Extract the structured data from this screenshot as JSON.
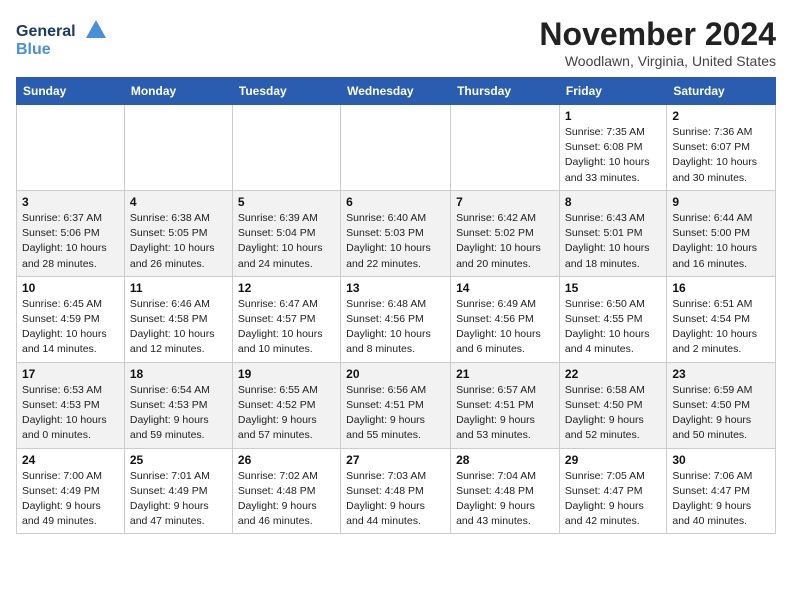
{
  "header": {
    "logo_line1": "General",
    "logo_line2": "Blue",
    "month": "November 2024",
    "location": "Woodlawn, Virginia, United States"
  },
  "weekdays": [
    "Sunday",
    "Monday",
    "Tuesday",
    "Wednesday",
    "Thursday",
    "Friday",
    "Saturday"
  ],
  "weeks": [
    [
      {
        "day": "",
        "info": ""
      },
      {
        "day": "",
        "info": ""
      },
      {
        "day": "",
        "info": ""
      },
      {
        "day": "",
        "info": ""
      },
      {
        "day": "",
        "info": ""
      },
      {
        "day": "1",
        "info": "Sunrise: 7:35 AM\nSunset: 6:08 PM\nDaylight: 10 hours\nand 33 minutes."
      },
      {
        "day": "2",
        "info": "Sunrise: 7:36 AM\nSunset: 6:07 PM\nDaylight: 10 hours\nand 30 minutes."
      }
    ],
    [
      {
        "day": "3",
        "info": "Sunrise: 6:37 AM\nSunset: 5:06 PM\nDaylight: 10 hours\nand 28 minutes."
      },
      {
        "day": "4",
        "info": "Sunrise: 6:38 AM\nSunset: 5:05 PM\nDaylight: 10 hours\nand 26 minutes."
      },
      {
        "day": "5",
        "info": "Sunrise: 6:39 AM\nSunset: 5:04 PM\nDaylight: 10 hours\nand 24 minutes."
      },
      {
        "day": "6",
        "info": "Sunrise: 6:40 AM\nSunset: 5:03 PM\nDaylight: 10 hours\nand 22 minutes."
      },
      {
        "day": "7",
        "info": "Sunrise: 6:42 AM\nSunset: 5:02 PM\nDaylight: 10 hours\nand 20 minutes."
      },
      {
        "day": "8",
        "info": "Sunrise: 6:43 AM\nSunset: 5:01 PM\nDaylight: 10 hours\nand 18 minutes."
      },
      {
        "day": "9",
        "info": "Sunrise: 6:44 AM\nSunset: 5:00 PM\nDaylight: 10 hours\nand 16 minutes."
      }
    ],
    [
      {
        "day": "10",
        "info": "Sunrise: 6:45 AM\nSunset: 4:59 PM\nDaylight: 10 hours\nand 14 minutes."
      },
      {
        "day": "11",
        "info": "Sunrise: 6:46 AM\nSunset: 4:58 PM\nDaylight: 10 hours\nand 12 minutes."
      },
      {
        "day": "12",
        "info": "Sunrise: 6:47 AM\nSunset: 4:57 PM\nDaylight: 10 hours\nand 10 minutes."
      },
      {
        "day": "13",
        "info": "Sunrise: 6:48 AM\nSunset: 4:56 PM\nDaylight: 10 hours\nand 8 minutes."
      },
      {
        "day": "14",
        "info": "Sunrise: 6:49 AM\nSunset: 4:56 PM\nDaylight: 10 hours\nand 6 minutes."
      },
      {
        "day": "15",
        "info": "Sunrise: 6:50 AM\nSunset: 4:55 PM\nDaylight: 10 hours\nand 4 minutes."
      },
      {
        "day": "16",
        "info": "Sunrise: 6:51 AM\nSunset: 4:54 PM\nDaylight: 10 hours\nand 2 minutes."
      }
    ],
    [
      {
        "day": "17",
        "info": "Sunrise: 6:53 AM\nSunset: 4:53 PM\nDaylight: 10 hours\nand 0 minutes."
      },
      {
        "day": "18",
        "info": "Sunrise: 6:54 AM\nSunset: 4:53 PM\nDaylight: 9 hours\nand 59 minutes."
      },
      {
        "day": "19",
        "info": "Sunrise: 6:55 AM\nSunset: 4:52 PM\nDaylight: 9 hours\nand 57 minutes."
      },
      {
        "day": "20",
        "info": "Sunrise: 6:56 AM\nSunset: 4:51 PM\nDaylight: 9 hours\nand 55 minutes."
      },
      {
        "day": "21",
        "info": "Sunrise: 6:57 AM\nSunset: 4:51 PM\nDaylight: 9 hours\nand 53 minutes."
      },
      {
        "day": "22",
        "info": "Sunrise: 6:58 AM\nSunset: 4:50 PM\nDaylight: 9 hours\nand 52 minutes."
      },
      {
        "day": "23",
        "info": "Sunrise: 6:59 AM\nSunset: 4:50 PM\nDaylight: 9 hours\nand 50 minutes."
      }
    ],
    [
      {
        "day": "24",
        "info": "Sunrise: 7:00 AM\nSunset: 4:49 PM\nDaylight: 9 hours\nand 49 minutes."
      },
      {
        "day": "25",
        "info": "Sunrise: 7:01 AM\nSunset: 4:49 PM\nDaylight: 9 hours\nand 47 minutes."
      },
      {
        "day": "26",
        "info": "Sunrise: 7:02 AM\nSunset: 4:48 PM\nDaylight: 9 hours\nand 46 minutes."
      },
      {
        "day": "27",
        "info": "Sunrise: 7:03 AM\nSunset: 4:48 PM\nDaylight: 9 hours\nand 44 minutes."
      },
      {
        "day": "28",
        "info": "Sunrise: 7:04 AM\nSunset: 4:48 PM\nDaylight: 9 hours\nand 43 minutes."
      },
      {
        "day": "29",
        "info": "Sunrise: 7:05 AM\nSunset: 4:47 PM\nDaylight: 9 hours\nand 42 minutes."
      },
      {
        "day": "30",
        "info": "Sunrise: 7:06 AM\nSunset: 4:47 PM\nDaylight: 9 hours\nand 40 minutes."
      }
    ]
  ]
}
